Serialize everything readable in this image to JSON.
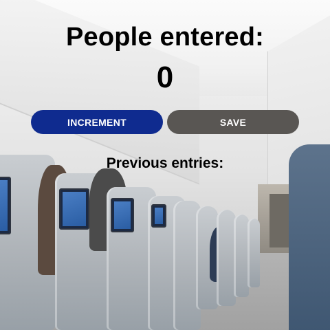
{
  "title": "People entered:",
  "count": "0",
  "buttons": {
    "increment_label": "INCREMENT",
    "save_label": "SAVE"
  },
  "previous_entries": {
    "label": "Previous entries:",
    "items": []
  },
  "colors": {
    "increment_button": "#0f2b8f",
    "save_button": "#595653",
    "text": "#000000"
  },
  "background": {
    "scene": "airplane-cabin-photo"
  }
}
